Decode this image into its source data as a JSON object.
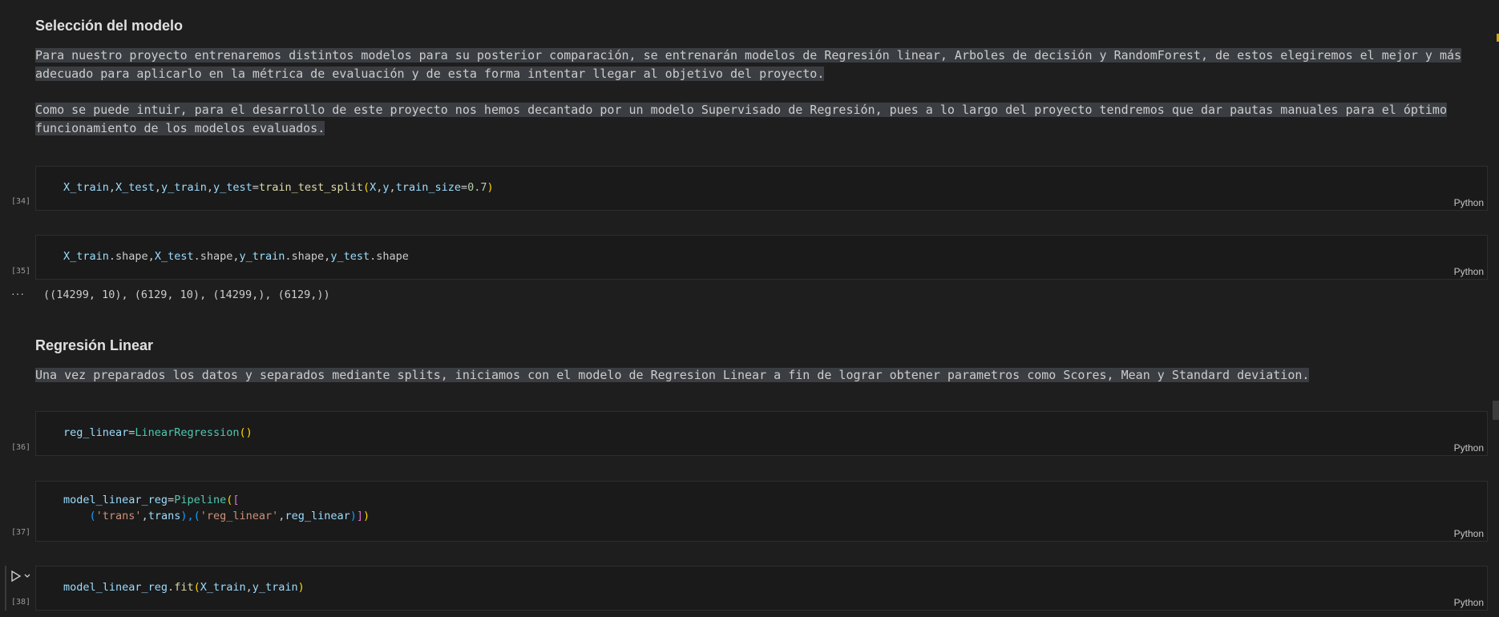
{
  "sections": {
    "seleccion_title": "Selección del modelo",
    "seleccion_p1_l1": "Para nuestro proyecto entrenaremos distintos modelos para su posterior comparación, se entrenarán modelos de Regresión linear, Arboles de decisión y RandomForest, de estos elegiremos el mejor y más",
    "seleccion_p1_l2": "adecuado para aplicarlo en la métrica de evaluación y de esta forma intentar llegar al objetivo del proyecto.",
    "seleccion_p2_l1": "Como se puede intuir, para el desarrollo de este proyecto nos hemos decantado por un modelo Supervisado de Regresión, pues a lo largo del proyecto tendremos que dar pautas manuales para el óptimo",
    "seleccion_p2_l2": "funcionamiento de los modelos evaluados.",
    "regresion_title": "Regresión Linear",
    "regresion_p1": "Una vez preparados los datos y separados mediante splits, iniciamos con el modelo de Regresion Linear a fin de lograr obtener parametros como Scores, Mean y Standard deviation."
  },
  "cells": [
    {
      "count": "[34]",
      "language": "Python"
    },
    {
      "count": "[35]",
      "language": "Python",
      "output": "((14299, 10), (6129, 10), (14299,), (6129,))",
      "output_marker": "···"
    },
    {
      "count": "[36]",
      "language": "Python"
    },
    {
      "count": "[37]",
      "language": "Python"
    },
    {
      "count": "[38]",
      "language": "Python"
    }
  ],
  "code": {
    "c34": {
      "a": "X_train",
      "b": ",",
      "c": "X_test",
      "d": ",",
      "e": "y_train",
      "f": ",",
      "g": "y_test",
      "h": "=",
      "i": "train_test_split",
      "j": "(",
      "k": "X",
      "l": ",",
      "m": "y",
      "n": ",",
      "o": "train_size",
      "p": "=",
      "q": "0.7",
      "r": ")"
    },
    "c35": {
      "a": "X_train",
      "b": ".shape,",
      "c": "X_test",
      "d": ".shape,",
      "e": "y_train",
      "f": ".shape,",
      "g": "y_test",
      "h": ".shape"
    },
    "c36": {
      "a": "reg_linear",
      "b": "=",
      "c": "LinearRegression",
      "d": "()"
    },
    "c37": {
      "a": "model_linear_reg",
      "b": "=",
      "c": "Pipeline",
      "d": "(",
      "e": "[",
      "f": "    ",
      "g": "(",
      "h": "'trans'",
      "i": ",",
      "j": "trans",
      "k": "),",
      "l": "(",
      "m": "'reg_linear'",
      "n": ",",
      "o": "reg_linear",
      "p": ")",
      "q": "]",
      "r": ")"
    },
    "c38": {
      "a": "model_linear_reg",
      "b": ".",
      "c": "fit",
      "d": "(",
      "e": "X_train",
      "f": ",",
      "g": "y_train",
      "h": ")"
    }
  },
  "icons": {
    "run": "play-icon",
    "chevron": "chevron-down-icon"
  }
}
